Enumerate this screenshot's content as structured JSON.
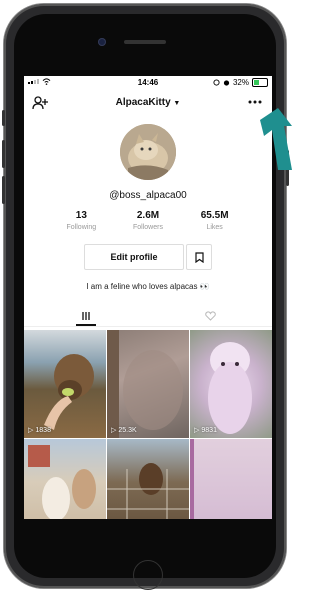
{
  "status_bar": {
    "time": "14:46",
    "battery": "32%"
  },
  "header": {
    "username": "AlpacaKitty"
  },
  "profile": {
    "handle": "@boss_alpaca00",
    "stats": [
      {
        "value": "13",
        "label": "Following"
      },
      {
        "value": "2.6M",
        "label": "Followers"
      },
      {
        "value": "65.5M",
        "label": "Likes"
      }
    ],
    "edit_label": "Edit profile",
    "bio": "I am a feline who loves alpacas 👀"
  },
  "videos": [
    {
      "views": "1838"
    },
    {
      "views": "25.3K"
    },
    {
      "views": "9831"
    },
    {
      "views": ""
    },
    {
      "views": ""
    },
    {
      "views": ""
    }
  ],
  "colors": {
    "accent_arrow": "#1f8f8f",
    "battery_green": "#35c759"
  }
}
